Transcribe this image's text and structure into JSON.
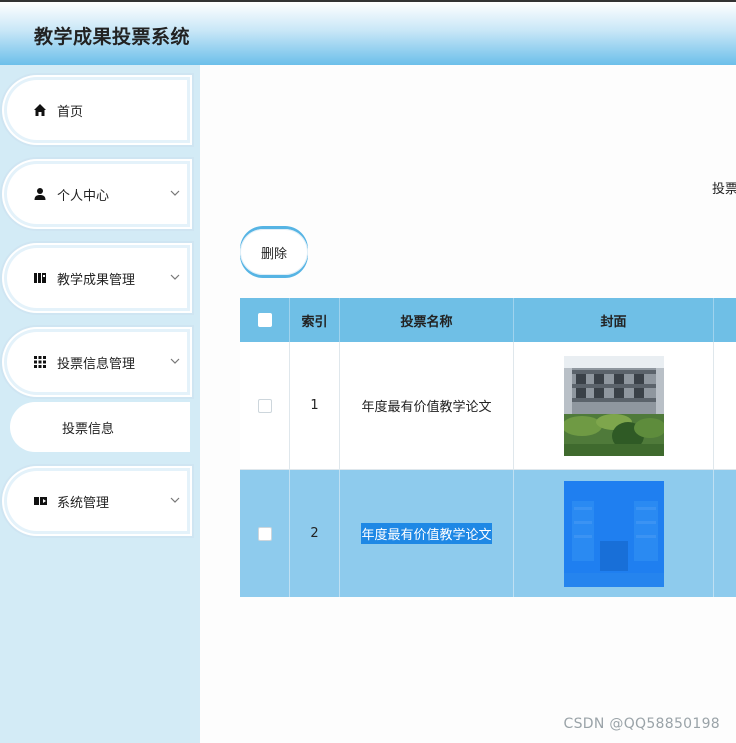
{
  "app": {
    "title": "教学成果投票系统"
  },
  "sidebar": {
    "items": [
      {
        "label": "首页",
        "icon": "home-icon"
      },
      {
        "label": "个人中心",
        "icon": "user-icon"
      },
      {
        "label": "教学成果管理",
        "icon": "book-icon"
      },
      {
        "label": "投票信息管理",
        "icon": "grid-icon"
      },
      {
        "label": "系统管理",
        "icon": "ticket-icon"
      }
    ],
    "submenu": {
      "label": "投票信息"
    }
  },
  "search": {
    "label": "投票"
  },
  "toolbar": {
    "delete_label": "删除"
  },
  "table": {
    "headers": [
      "索引",
      "投票名称",
      "封面"
    ],
    "rows": [
      {
        "index": "1",
        "name": "年度最有价值教学论文"
      },
      {
        "index": "2",
        "name": "年度最有价值教学论文"
      }
    ]
  },
  "watermark": "CSDN @QQ58850198",
  "colors": {
    "header": "#6fbfe6",
    "selected_row": "#8ecbed",
    "sidebar": "#d3ebf6",
    "selection": "#1e88e5"
  }
}
